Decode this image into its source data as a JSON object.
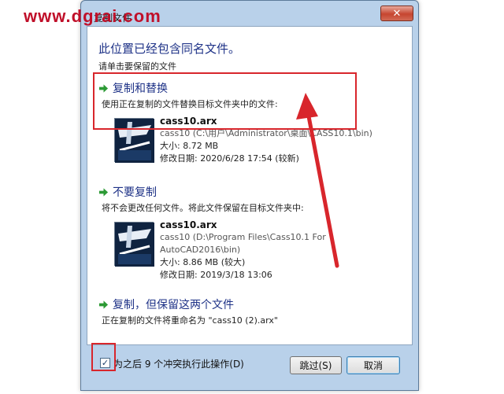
{
  "watermark": "www.dgrai.com",
  "window": {
    "title": "复制文件",
    "close_label": "✕"
  },
  "dialog": {
    "heading": "此位置已经包含同名文件。",
    "subheading": "请单击要保留的文件"
  },
  "options": [
    {
      "title": "复制和替换",
      "desc": "使用正在复制的文件替换目标文件夹中的文件:",
      "file": {
        "name": "cass10.arx",
        "path_lines": [
          "cass10 (C:\\用户\\Administrator\\桌面\\CASS10.1\\bin)"
        ],
        "size": "大小: 8.72 MB",
        "date": "修改日期: 2020/6/28 17:54 (较新)"
      }
    },
    {
      "title": "不要复制",
      "desc": "将不会更改任何文件。将此文件保留在目标文件夹中:",
      "file": {
        "name": "cass10.arx",
        "path_lines": [
          "cass10 (D:\\Program Files\\Cass10.1 For",
          "AutoCAD2016\\bin)"
        ],
        "size": "大小: 8.86 MB (较大)",
        "date": "修改日期: 2019/3/18 13:06"
      }
    },
    {
      "title": "复制，但保留这两个文件",
      "desc": "正在复制的文件将重命名为 \"cass10 (2).arx\""
    }
  ],
  "footer": {
    "checkbox_checked": true,
    "checkbox_mark": "✓",
    "checkbox_label": "为之后 9 个冲突执行此操作(D)",
    "skip_label": "跳过(S)",
    "cancel_label": "取消"
  },
  "colors": {
    "heading_blue": "#1e3287",
    "annotation_red": "#d8262c",
    "frame_blue": "#b9d1ea",
    "arrow_green": "#2c9a35"
  },
  "icons": {
    "option_arrow": "green-right-arrow-icon",
    "file": "arx-file-icon"
  }
}
